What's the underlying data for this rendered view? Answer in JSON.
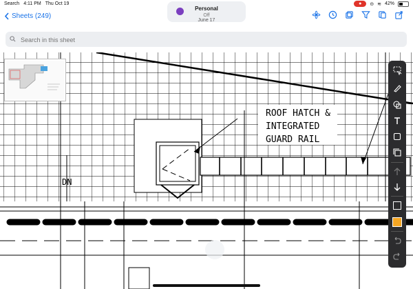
{
  "status": {
    "left": [
      "Search",
      "4:11 PM",
      "Thu Oct 19"
    ],
    "battery": "42%"
  },
  "focus": {
    "title": "Personal",
    "subtitle": "Off",
    "date_peek": "June 17"
  },
  "nav": {
    "back_label": "Sheets (249)"
  },
  "search": {
    "placeholder": "Search in this sheet"
  },
  "drawing": {
    "callout": [
      "ROOF HATCH &",
      "INTEGRATED",
      "GUARD RAIL"
    ],
    "label_dn": "DN"
  },
  "palette": {
    "selected_color": "#f5a623"
  },
  "colors": {
    "accent": "#1a73e8",
    "palette_bg": "#2c2c2e"
  }
}
